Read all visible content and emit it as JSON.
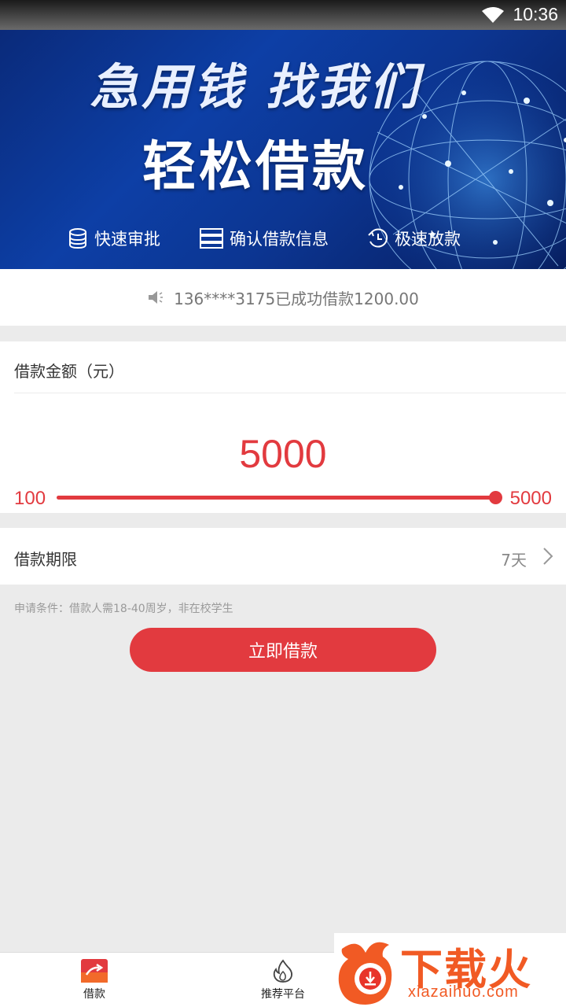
{
  "status_bar": {
    "time": "10:36",
    "wifi_icon": "wifi-icon"
  },
  "banner": {
    "line1": "急用钱 找我们",
    "line2": "轻松借款",
    "features": [
      {
        "icon": "coins-icon",
        "label": "快速审批"
      },
      {
        "icon": "server-icon",
        "label": "确认借款信息"
      },
      {
        "icon": "clock-icon",
        "label": "极速放款"
      }
    ]
  },
  "notice": {
    "icon": "speaker-icon",
    "text": "136****3175已成功借款1200.00"
  },
  "amount": {
    "title": "借款金额（元）",
    "value": "5000",
    "min": "100",
    "max": "5000",
    "fill_fraction": 1.0
  },
  "term": {
    "label": "借款期限",
    "value": "7天"
  },
  "conditions": "申请条件：借款人需18-40周岁，非在校学生",
  "apply_button": "立即借款",
  "tabbar": {
    "tabs": [
      {
        "label": "借款",
        "icon": "loan-icon",
        "active": true
      },
      {
        "label": "推荐平台",
        "icon": "flame-icon",
        "active": false
      }
    ]
  },
  "watermark": {
    "title": "下载火",
    "subtitle": "xiazaihuo.com"
  },
  "colors": {
    "accent": "#e23a3f",
    "banner": "#0d3fa6",
    "watermark": "#f15a24"
  }
}
